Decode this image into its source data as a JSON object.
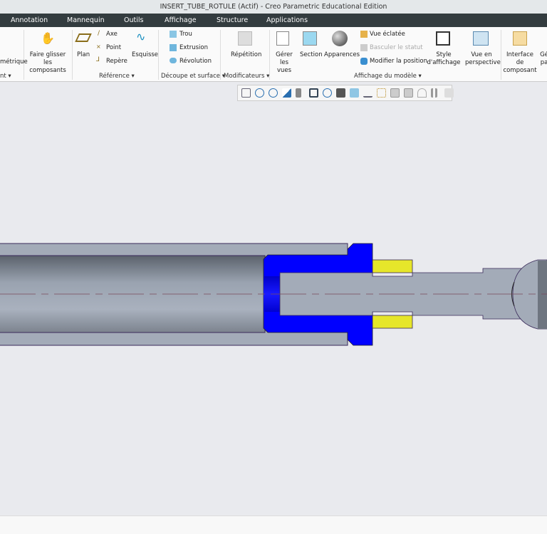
{
  "title": "INSERT_TUBE_ROTULE (Actif) - Creo Parametric Educational Edition",
  "menu": [
    "Annotation",
    "Mannequin",
    "Outils",
    "Affichage",
    "Structure",
    "Applications"
  ],
  "ribbon": {
    "partial_left": "métrique",
    "partial_group_left": "nt",
    "drag": "Faire glisser les composants",
    "plan": "Plan",
    "axe": "Axe",
    "point": "Point",
    "repere": "Repère",
    "esquisse": "Esquisse",
    "group_reference": "Référence",
    "trou": "Trou",
    "extrusion": "Extrusion",
    "revolution": "Révolution",
    "group_decoupe": "Découpe et surface",
    "repetition": "Répétition",
    "group_modif": "Modificateurs",
    "gerer_vues": "Gérer les vues",
    "section": "Section",
    "apparences": "Apparences",
    "vue_eclatee": "Vue éclatée",
    "basculer": "Basculer le statut",
    "modifier_position": "Modifier la position",
    "style": "Style d'affichage",
    "perspective": "Vue en perspective",
    "group_affichage": "Affichage du modèle",
    "interface": "Interface de composant",
    "partial_right": "Gé pa"
  },
  "colors": {
    "insert": "#0000ff",
    "ring": "#e6e62a",
    "part": "#a3abb8"
  }
}
